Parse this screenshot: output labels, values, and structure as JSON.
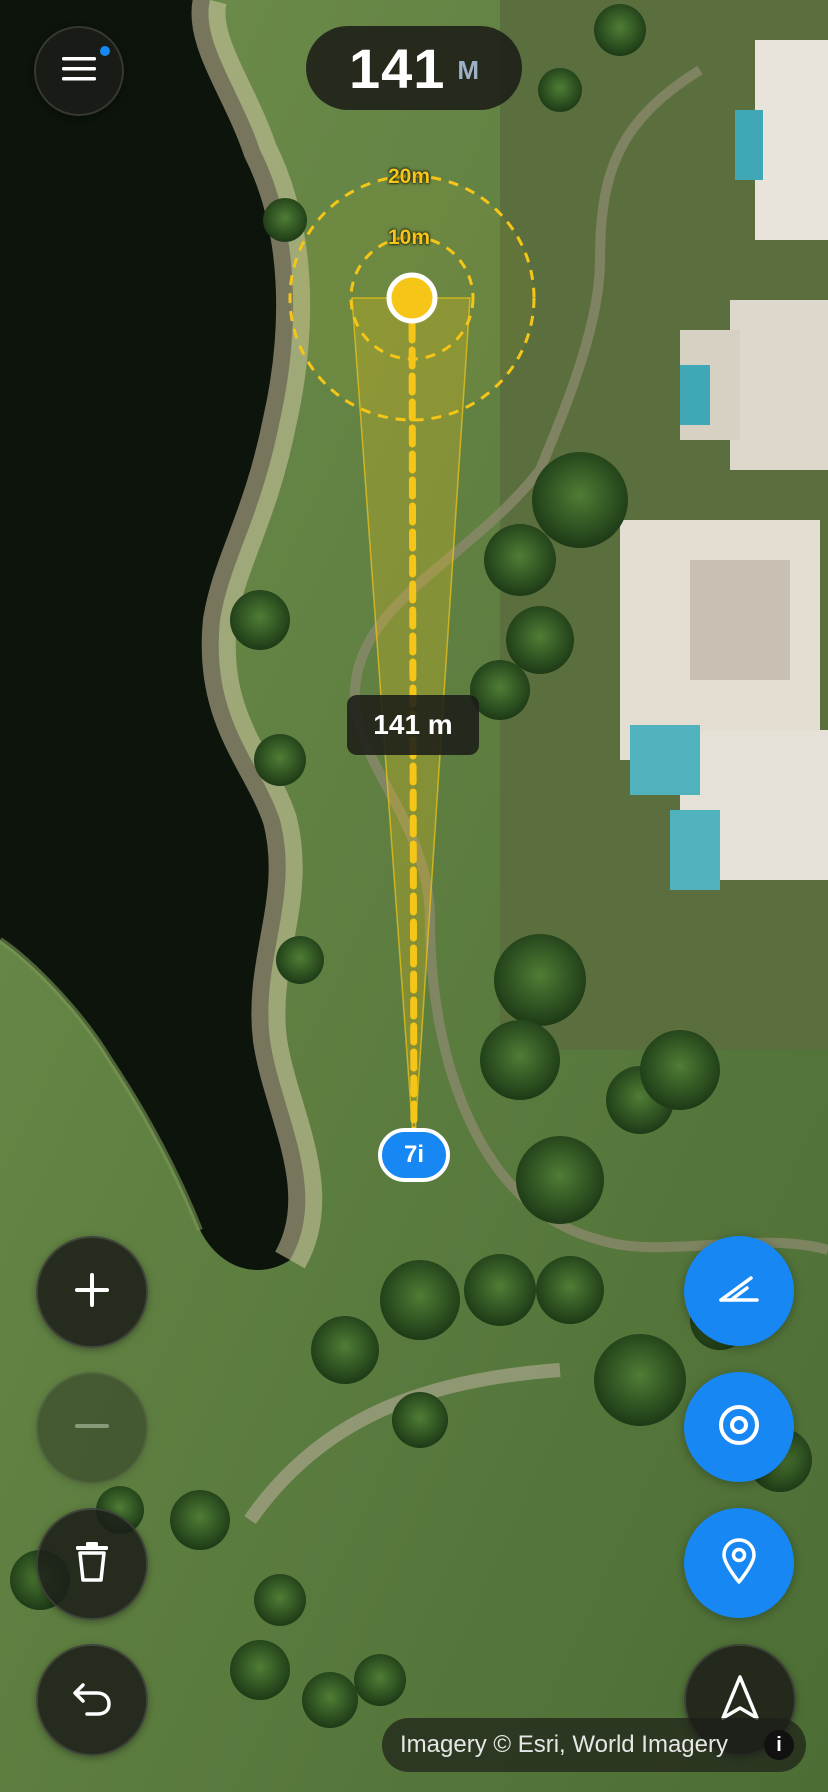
{
  "header": {
    "distance_value": "141",
    "distance_unit": "M",
    "menu_icon": "hamburger-menu-icon"
  },
  "rings": {
    "outer": "20m",
    "inner": "10m"
  },
  "shot": {
    "distance_label": "141 m",
    "club": "7i",
    "target_color": "#f5c518"
  },
  "controls": {
    "zoom_in_icon": "plus-icon",
    "zoom_out_icon": "minus-icon",
    "delete_icon": "trash-icon",
    "undo_icon": "undo-icon",
    "draw_icon": "pencil-icon",
    "target_icon": "target-icon",
    "pin_icon": "location-pin-icon",
    "navigate_icon": "navigation-arrow-icon"
  },
  "attribution": {
    "text": "Imagery © Esri, World Imagery",
    "info_icon": "info-icon"
  },
  "colors": {
    "accent": "#1787f3",
    "target": "#f5c518",
    "panel": "#1c1e18"
  }
}
